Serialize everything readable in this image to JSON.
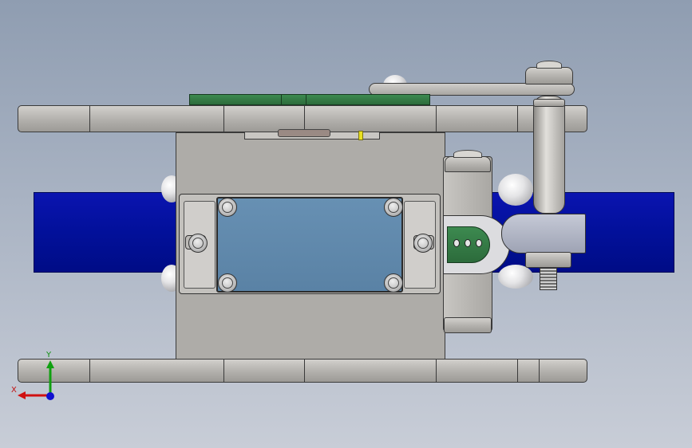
{
  "viewport": {
    "background_top": "#8f9db1",
    "background_bottom": "#c8cdd7"
  },
  "colors": {
    "band": "#02109a",
    "steel": "#b0aeab",
    "pcb": "#2c6b3b",
    "sensor_window": "#5f86a8",
    "bracket": "#a9adbb",
    "axis_x": "#d01010",
    "axis_y": "#10a010",
    "axis_z": "#1010d0"
  },
  "triad": {
    "x_label": "X",
    "y_label": "Y"
  },
  "icons": {
    "axis_triad": "xyz-axis-triad-icon",
    "fastener": "screw-icon",
    "nut": "hex-nut-icon"
  }
}
